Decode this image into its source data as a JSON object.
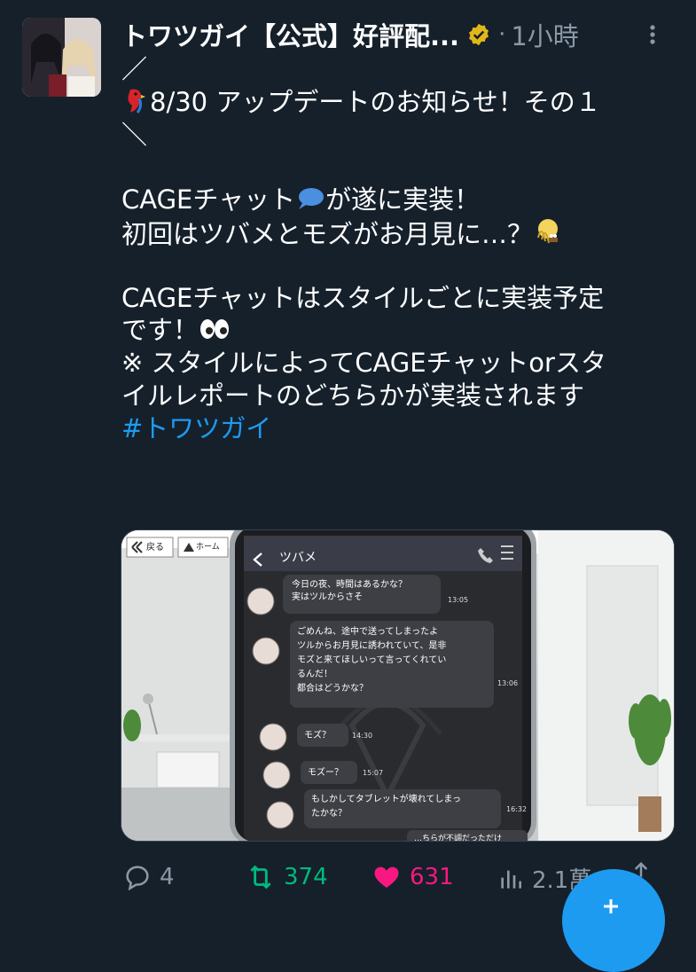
{
  "tweet": {
    "author": "トワツガイ【公式】好評配...",
    "separator": "·",
    "time": "1小時",
    "lines": [
      "／",
      "8/30 アップデートのお知らせ！その１",
      "＼",
      "",
      "CAGEチャット",
      "が遂に実装！",
      "初回はツバメとモズがお月見に…？",
      "",
      "CAGEチャットはスタイルごとに実装予定",
      "です！",
      "※ スタイルによってCAGEチャットorスタ",
      "イルレポートのどちらかが実装されます"
    ],
    "hashtag": "#トワツガイ"
  },
  "media": {
    "back_button": "戻る",
    "home_button": "ホーム",
    "chat_title": "ツバメ",
    "messages": [
      {
        "lines": [
          "今日の夜、時間はあるかな？",
          "実はツルからさそ"
        ],
        "time": "13:05"
      },
      {
        "lines": [
          "ごめんね、途中で送ってしまったよ",
          "ツルからお月見に誘われていて、是非",
          "モズと来てほしいって言ってくれてい",
          "るんだ！",
          "都合はどうかな？"
        ],
        "time": "13:06"
      },
      {
        "lines": [
          "モズ？"
        ],
        "time": "14:30"
      },
      {
        "lines": [
          "モズー？"
        ],
        "time": "15:07"
      },
      {
        "lines": [
          "もしかしてタブレットが壊れてしまっ",
          "たかな？"
        ],
        "time": "16:32"
      },
      {
        "lines": [
          "…ちらが不調だっただけ"
        ],
        "time": ""
      }
    ]
  },
  "actions": {
    "replies": "4",
    "retweets": "374",
    "likes": "631",
    "views": "2.1萬"
  },
  "colors": {
    "background": "#15202b",
    "hashtag": "#1d9bf0",
    "retweet": "#00ba7c",
    "like": "#f91880",
    "secondary": "#8b98a5"
  }
}
